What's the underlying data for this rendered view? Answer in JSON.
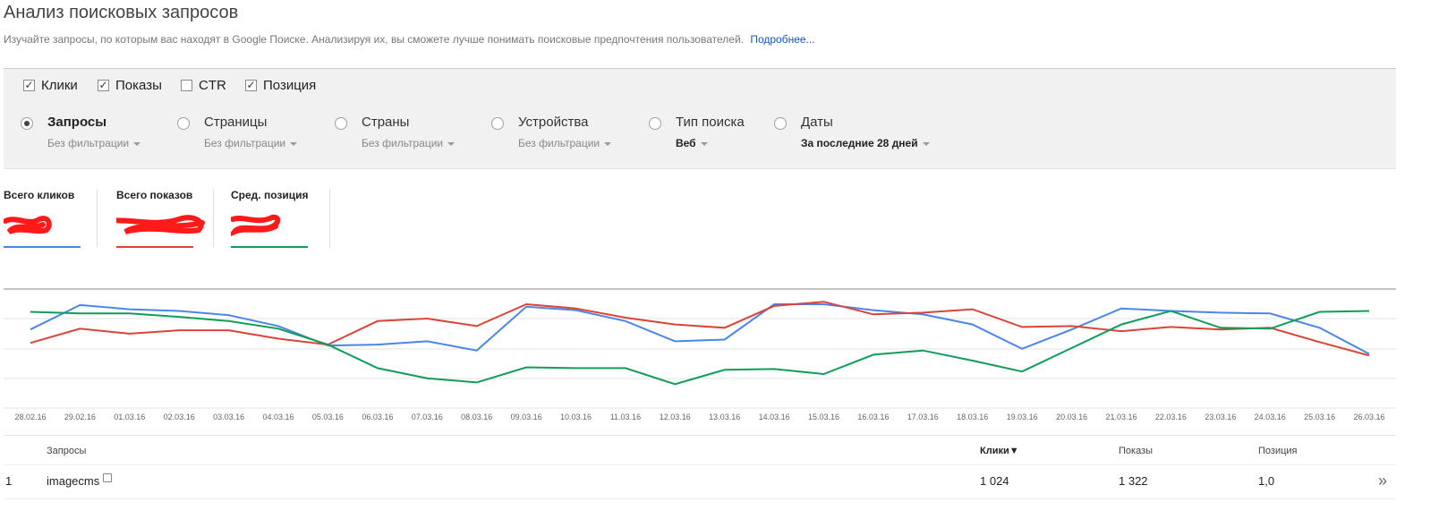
{
  "header": {
    "title": "Анализ поисковых запросов",
    "description": "Изучайте запросы, по которым вас находят в Google Поиске. Анализируя их, вы сможете лучше понимать поисковые предпочтения пользователей.",
    "more_link": "Подробнее..."
  },
  "metrics": [
    {
      "label": "Клики",
      "checked": true
    },
    {
      "label": "Показы",
      "checked": true
    },
    {
      "label": "CTR",
      "checked": false
    },
    {
      "label": "Позиция",
      "checked": true
    }
  ],
  "groups": [
    {
      "name": "Запросы",
      "sub": "Без фильтрации",
      "selected": true
    },
    {
      "name": "Страницы",
      "sub": "Без фильтрации",
      "selected": false
    },
    {
      "name": "Страны",
      "sub": "Без фильтрации",
      "selected": false
    },
    {
      "name": "Устройства",
      "sub": "Без фильтрации",
      "selected": false
    },
    {
      "name": "Тип поиска",
      "sub": "Веб",
      "selected": false
    },
    {
      "name": "Даты",
      "sub": "За последние 28 дней",
      "selected": false
    }
  ],
  "totals": [
    {
      "label": "Всего кликов",
      "color": "#4a86e8"
    },
    {
      "label": "Всего показов",
      "color": "#db4437"
    },
    {
      "label": "Сред. позиция",
      "color": "#0f9d58"
    }
  ],
  "chart_data": {
    "type": "line",
    "x": [
      "28.02.16",
      "29.02.16",
      "01.03.16",
      "02.03.16",
      "03.03.16",
      "04.03.16",
      "05.03.16",
      "06.03.16",
      "07.03.16",
      "08.03.16",
      "09.03.16",
      "10.03.16",
      "11.03.16",
      "12.03.16",
      "13.03.16",
      "14.03.16",
      "15.03.16",
      "16.03.16",
      "17.03.16",
      "18.03.16",
      "19.03.16",
      "20.03.16",
      "21.03.16",
      "22.03.16",
      "23.03.16",
      "24.03.16",
      "25.03.16",
      "26.03.16"
    ],
    "series": [
      {
        "name": "Всего кликов",
        "color": "#4a86e8",
        "values": [
          0.7,
          0.99,
          0.94,
          0.92,
          0.87,
          0.74,
          0.51,
          0.52,
          0.56,
          0.45,
          0.97,
          0.93,
          0.8,
          0.56,
          0.58,
          1.0,
          1.0,
          0.93,
          0.88,
          0.76,
          0.47,
          0.7,
          0.95,
          0.92,
          0.9,
          0.89,
          0.72,
          0.41
        ]
      },
      {
        "name": "Всего показов",
        "color": "#db4437",
        "values": [
          0.54,
          0.71,
          0.65,
          0.69,
          0.69,
          0.59,
          0.52,
          0.8,
          0.83,
          0.74,
          1.0,
          0.95,
          0.84,
          0.76,
          0.72,
          0.98,
          1.03,
          0.88,
          0.9,
          0.94,
          0.73,
          0.74,
          0.68,
          0.73,
          0.7,
          0.72,
          0.55,
          0.39
        ]
      },
      {
        "name": "Сред. позиция",
        "color": "#0f9d58",
        "values": [
          0.91,
          0.89,
          0.89,
          0.85,
          0.8,
          0.71,
          0.52,
          0.24,
          0.12,
          0.07,
          0.25,
          0.24,
          0.24,
          0.05,
          0.22,
          0.23,
          0.17,
          0.4,
          0.45,
          0.33,
          0.2,
          0.48,
          0.76,
          0.92,
          0.72,
          0.71,
          0.91,
          0.92
        ]
      }
    ]
  },
  "table": {
    "headers": {
      "index": "",
      "query": "Запросы",
      "clicks": "Клики",
      "impressions": "Показы",
      "position": "Позиция"
    },
    "rows": [
      {
        "index": "1",
        "query": "imagecms",
        "clicks": "1 024",
        "impressions": "1 322",
        "position": "1,0"
      }
    ]
  }
}
